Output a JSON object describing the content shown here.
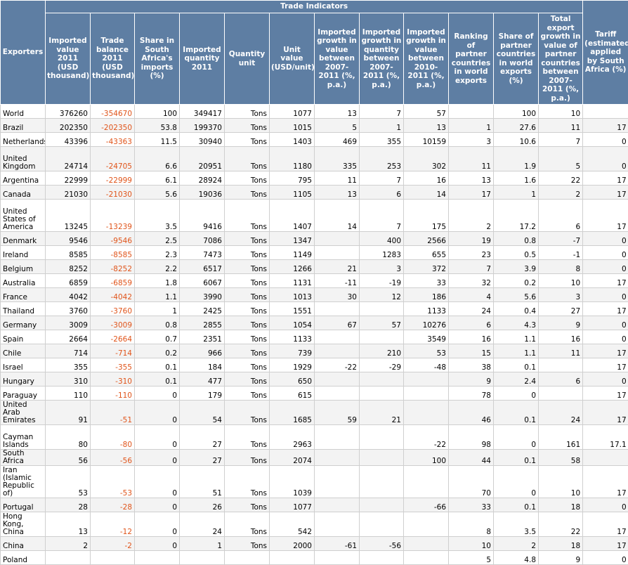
{
  "table": {
    "group_header": "Trade Indicators",
    "columns": [
      "Exporters",
      "Imported value 2011 (USD thousand)",
      "Trade balance 2011 (USD thousand)",
      "Share in South Africa's imports (%)",
      "Imported quantity 2011",
      "Quantity unit",
      "Unit value (USD/unit)",
      "Imported growth in value between 2007-2011 (%, p.a.)",
      "Imported growth in quantity between 2007-2011 (%, p.a.)",
      "Imported growth in value between 2010-2011 (%, p.a.)",
      "Ranking of partner countries in world exports",
      "Share of partner countries in world exports (%)",
      "Total export growth in value of partner countries between 2007-2011 (%, p.a.)",
      "Tariff (estimated) applied by South Africa (%)"
    ],
    "rows": [
      [
        "World",
        "376260",
        "-354670",
        "100",
        "349417",
        "Tons",
        "1077",
        "13",
        "7",
        "57",
        "",
        "100",
        "10",
        ""
      ],
      [
        "Brazil",
        "202350",
        "-202350",
        "53.8",
        "199370",
        "Tons",
        "1015",
        "5",
        "1",
        "13",
        "1",
        "27.6",
        "11",
        "17"
      ],
      [
        "Netherlands",
        "43396",
        "-43363",
        "11.5",
        "30940",
        "Tons",
        "1403",
        "469",
        "355",
        "10159",
        "3",
        "10.6",
        "7",
        "0"
      ],
      [
        "United Kingdom",
        "24714",
        "-24705",
        "6.6",
        "20951",
        "Tons",
        "1180",
        "335",
        "253",
        "302",
        "11",
        "1.9",
        "5",
        "0"
      ],
      [
        "Argentina",
        "22999",
        "-22999",
        "6.1",
        "28924",
        "Tons",
        "795",
        "11",
        "7",
        "16",
        "13",
        "1.6",
        "22",
        "17"
      ],
      [
        "Canada",
        "21030",
        "-21030",
        "5.6",
        "19036",
        "Tons",
        "1105",
        "13",
        "6",
        "14",
        "17",
        "1",
        "2",
        "17"
      ],
      [
        "United States of America",
        "13245",
        "-13239",
        "3.5",
        "9416",
        "Tons",
        "1407",
        "14",
        "7",
        "175",
        "2",
        "17.2",
        "6",
        "17"
      ],
      [
        "Denmark",
        "9546",
        "-9546",
        "2.5",
        "7086",
        "Tons",
        "1347",
        "",
        "400",
        "2566",
        "19",
        "0.8",
        "-7",
        "0"
      ],
      [
        "Ireland",
        "8585",
        "-8585",
        "2.3",
        "7473",
        "Tons",
        "1149",
        "",
        "1283",
        "655",
        "23",
        "0.5",
        "-1",
        "0"
      ],
      [
        "Belgium",
        "8252",
        "-8252",
        "2.2",
        "6517",
        "Tons",
        "1266",
        "21",
        "3",
        "372",
        "7",
        "3.9",
        "8",
        "0"
      ],
      [
        "Australia",
        "6859",
        "-6859",
        "1.8",
        "6067",
        "Tons",
        "1131",
        "-11",
        "-19",
        "33",
        "32",
        "0.2",
        "10",
        "17"
      ],
      [
        "France",
        "4042",
        "-4042",
        "1.1",
        "3990",
        "Tons",
        "1013",
        "30",
        "12",
        "186",
        "4",
        "5.6",
        "3",
        "0"
      ],
      [
        "Thailand",
        "3760",
        "-3760",
        "1",
        "2425",
        "Tons",
        "1551",
        "",
        "",
        "1133",
        "24",
        "0.4",
        "27",
        "17"
      ],
      [
        "Germany",
        "3009",
        "-3009",
        "0.8",
        "2855",
        "Tons",
        "1054",
        "67",
        "57",
        "10276",
        "6",
        "4.3",
        "9",
        "0"
      ],
      [
        "Spain",
        "2664",
        "-2664",
        "0.7",
        "2351",
        "Tons",
        "1133",
        "",
        "",
        "3549",
        "16",
        "1.1",
        "16",
        "0"
      ],
      [
        "Chile",
        "714",
        "-714",
        "0.2",
        "966",
        "Tons",
        "739",
        "",
        "210",
        "53",
        "15",
        "1.1",
        "11",
        "17"
      ],
      [
        "Israel",
        "355",
        "-355",
        "0.1",
        "184",
        "Tons",
        "1929",
        "-22",
        "-29",
        "-48",
        "38",
        "0.1",
        "",
        "17"
      ],
      [
        "Hungary",
        "310",
        "-310",
        "0.1",
        "477",
        "Tons",
        "650",
        "",
        "",
        "",
        "9",
        "2.4",
        "6",
        "0"
      ],
      [
        "Paraguay",
        "110",
        "-110",
        "0",
        "179",
        "Tons",
        "615",
        "",
        "",
        "",
        "78",
        "0",
        "",
        "17"
      ],
      [
        "United Arab Emirates",
        "91",
        "-51",
        "0",
        "54",
        "Tons",
        "1685",
        "59",
        "21",
        "",
        "46",
        "0.1",
        "24",
        "17"
      ],
      [
        "Cayman Islands",
        "80",
        "-80",
        "0",
        "27",
        "Tons",
        "2963",
        "",
        "",
        "-22",
        "98",
        "0",
        "161",
        "17.1"
      ],
      [
        "South Africa",
        "56",
        "-56",
        "0",
        "27",
        "Tons",
        "2074",
        "",
        "",
        "100",
        "44",
        "0.1",
        "58",
        ""
      ],
      [
        "Iran (Islamic Republic of)",
        "53",
        "-53",
        "0",
        "51",
        "Tons",
        "1039",
        "",
        "",
        "",
        "70",
        "0",
        "10",
        "17"
      ],
      [
        "Portugal",
        "28",
        "-28",
        "0",
        "26",
        "Tons",
        "1077",
        "",
        "",
        "-66",
        "33",
        "0.1",
        "18",
        "0"
      ],
      [
        "Hong Kong, China",
        "13",
        "-12",
        "0",
        "24",
        "Tons",
        "542",
        "",
        "",
        "",
        "8",
        "3.5",
        "22",
        "17"
      ],
      [
        "China",
        "2",
        "-2",
        "0",
        "1",
        "Tons",
        "2000",
        "-61",
        "-56",
        "",
        "10",
        "2",
        "18",
        "17"
      ],
      [
        "Poland",
        "",
        "",
        "",
        "",
        "",
        "",
        "",
        "",
        "",
        "5",
        "4.8",
        "9",
        "0"
      ]
    ]
  }
}
